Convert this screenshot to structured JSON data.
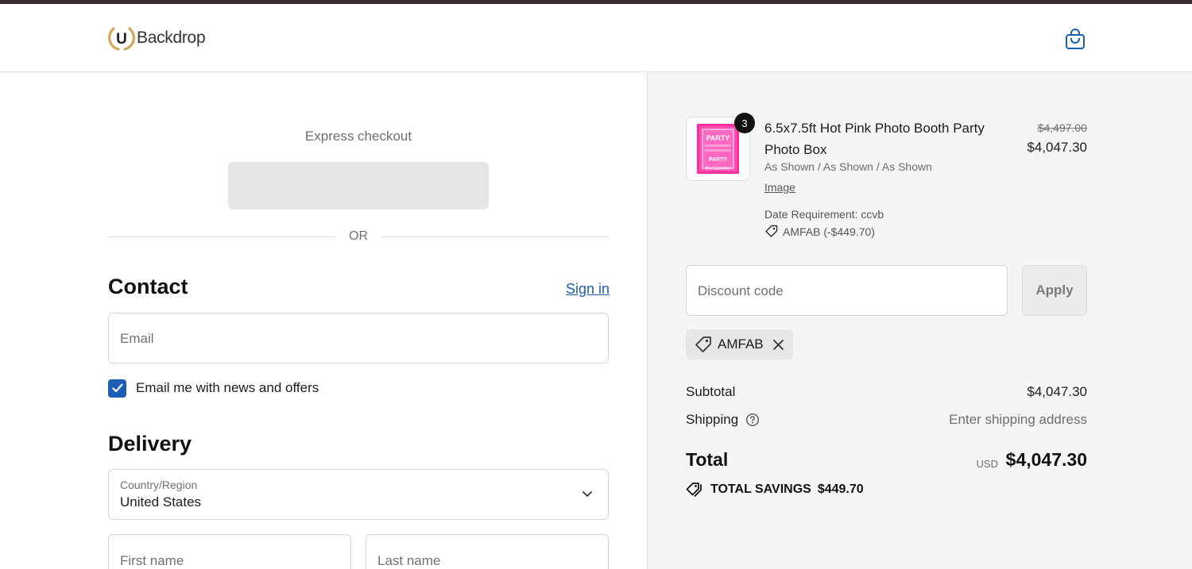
{
  "brand": {
    "logo_text": "Backdrop",
    "logo_letter": "U",
    "accent_color": "#1a5fb4",
    "logo_gold": "#d4a557"
  },
  "header": {
    "cart_icon": "shopping-bag-icon"
  },
  "express": {
    "title": "Express checkout",
    "or_text": "OR"
  },
  "contact": {
    "title": "Contact",
    "signin_label": "Sign in",
    "email_placeholder": "Email",
    "newsletter_label": "Email me with news and offers",
    "newsletter_checked": true
  },
  "delivery": {
    "title": "Delivery",
    "country_label": "Country/Region",
    "country_value": "United States",
    "first_name_placeholder": "First name",
    "last_name_placeholder": "Last name"
  },
  "cart": {
    "item": {
      "quantity": "3",
      "name": "6.5x7.5ft Hot Pink Photo Booth Party Photo Box",
      "variant": "As Shown / As Shown / As Shown",
      "link_label": "Image",
      "date_requirement": "Date Requirement: ccvb",
      "discount": "AMFAB (-$449.70)",
      "price_original": "$4,497.00",
      "price_final": "$4,047.30",
      "thumb_text_top": "PARTY",
      "thumb_text_mid": "PARTY",
      "thumb_text_bottom": "It's Summer"
    },
    "discount_placeholder": "Discount code",
    "apply_label": "Apply",
    "applied_code": "AMFAB",
    "subtotal_label": "Subtotal",
    "subtotal_value": "$4,047.30",
    "shipping_label": "Shipping",
    "shipping_value": "Enter shipping address",
    "total_label": "Total",
    "total_currency": "USD",
    "total_value": "$4,047.30",
    "savings_label": "TOTAL SAVINGS",
    "savings_value": "$449.70"
  }
}
